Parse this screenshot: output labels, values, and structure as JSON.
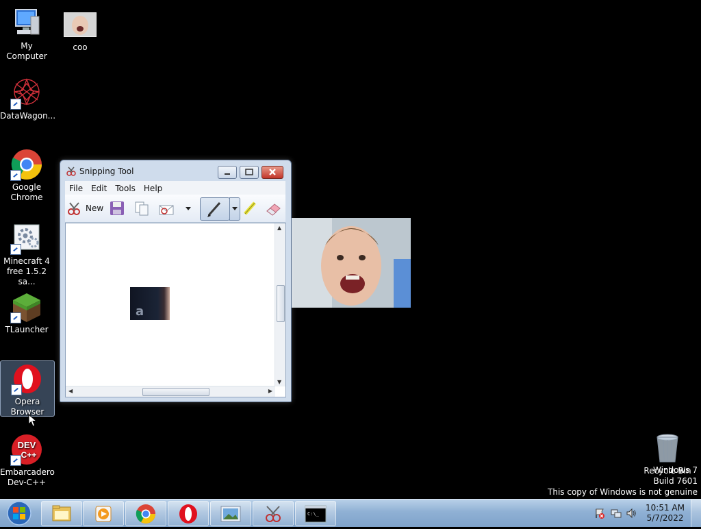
{
  "desktop": {
    "icons": [
      {
        "label": "My Computer"
      },
      {
        "label": "coo"
      },
      {
        "label": "DataWagon..."
      },
      {
        "label": "Google Chrome"
      },
      {
        "label": "Minecraft 4 free 1.5.2 sa..."
      },
      {
        "label": "TLauncher"
      },
      {
        "label": "Opera Browser"
      },
      {
        "label": "Embarcadero Dev-C++"
      },
      {
        "label": "Recycle Bin"
      }
    ],
    "selected_icon": "Opera Browser"
  },
  "snipping_tool": {
    "title": "Snipping Tool",
    "menu": [
      "File",
      "Edit",
      "Tools",
      "Help"
    ],
    "toolbar": {
      "new_label": "New",
      "icons": [
        "new-snip-icon",
        "save-icon",
        "copy-icon",
        "send-email-icon",
        "dropdown-icon",
        "pen-icon",
        "pen-dropdown-icon",
        "highlighter-icon",
        "eraser-icon"
      ]
    },
    "snip_letter": "a"
  },
  "watermark": {
    "line1": "Windows 7",
    "line2": "Build 7601",
    "line3": "This copy of Windows is not genuine"
  },
  "taskbar": {
    "apps": [
      "Windows Explorer",
      "Windows Media Player",
      "Google Chrome",
      "Opera Browser",
      "Photo Viewer",
      "Snipping Tool",
      "Command Prompt"
    ],
    "clock_time": "10:51 AM",
    "clock_date": "5/7/2022"
  },
  "colors": {
    "desktop_bg": "#000000",
    "taskbar": "#8fb0d4",
    "close_button": "#c2352a"
  }
}
